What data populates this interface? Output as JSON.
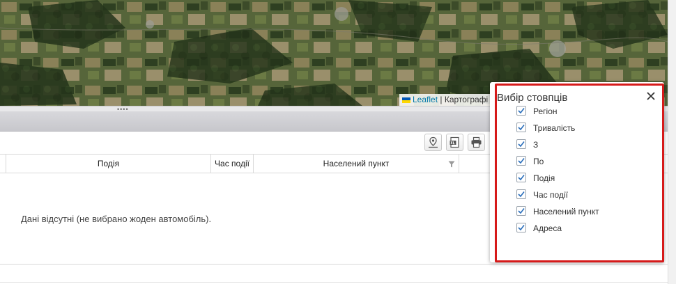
{
  "map": {
    "attribution_link": "Leaflet",
    "attribution_text": "| Картографі",
    "flag_colors": [
      "#0057b7",
      "#ffd700"
    ]
  },
  "toolbar": {
    "buttons": [
      {
        "icon": "map-pin-icon"
      },
      {
        "icon": "excel-export-icon"
      },
      {
        "icon": "print-icon"
      }
    ]
  },
  "table": {
    "columns": [
      "Подія",
      "Час події",
      "Населений пункт"
    ],
    "empty_message": "Дані відсутні (не вибрано жоден автомобіль)."
  },
  "column_chooser": {
    "title": "Вибір стовпців",
    "close_icon": "close-icon",
    "highlight_color": "#d61a1a",
    "options": [
      {
        "label": "Регіон",
        "checked": true
      },
      {
        "label": "Тривалість",
        "checked": true
      },
      {
        "label": "З",
        "checked": true
      },
      {
        "label": "По",
        "checked": true
      },
      {
        "label": "Подія",
        "checked": true
      },
      {
        "label": "Час події",
        "checked": true
      },
      {
        "label": "Населений пункт",
        "checked": true
      },
      {
        "label": "Адреса",
        "checked": true
      }
    ]
  }
}
